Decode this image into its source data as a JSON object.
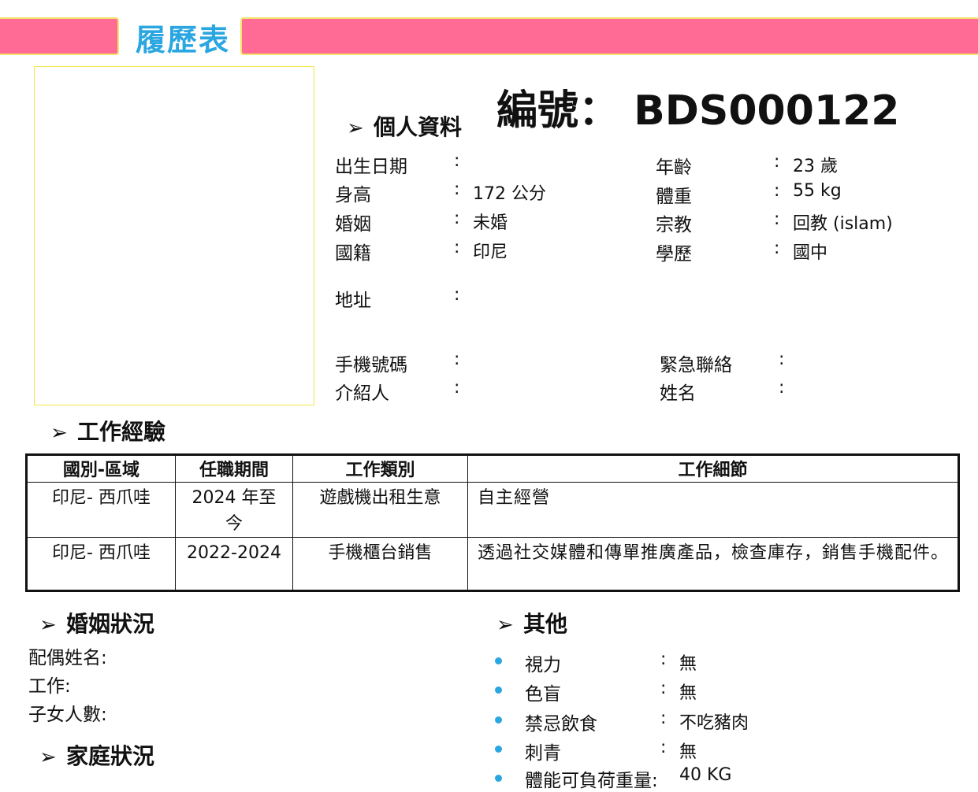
{
  "header": {
    "title": "履歷表",
    "band_color": "#ff6b95",
    "title_color": "#2aa6e0"
  },
  "id_code": "編號： BDS000122",
  "personal": {
    "section_title": "個人資料",
    "left": [
      {
        "label": "出生日期",
        "value": ""
      },
      {
        "label": "身高",
        "value": "172 公分"
      },
      {
        "label": "婚姻",
        "value": "未婚"
      },
      {
        "label": "國籍",
        "value": "印尼"
      }
    ],
    "right": [
      {
        "label": "年齡",
        "value": "23 歲"
      },
      {
        "label": "體重",
        "value": "55 kg"
      },
      {
        "label": "宗教",
        "value": "回教 (islam)"
      },
      {
        "label": "學歷",
        "value": "國中"
      }
    ],
    "address": {
      "label": "地址",
      "value": ""
    },
    "phone": {
      "label": "手機號碼",
      "value": ""
    },
    "referrer": {
      "label": "介紹人",
      "value": ""
    },
    "emergency": {
      "label": "緊急聯絡",
      "value": ""
    },
    "name": {
      "label": "姓名",
      "value": ""
    },
    "colon": ":"
  },
  "work": {
    "section_title": "工作經驗",
    "headers": [
      "國別-區域",
      "任職期間",
      "工作類別",
      "工作細節"
    ],
    "rows": [
      {
        "region": "印尼- 西爪哇",
        "period": "2024 年至今",
        "category": "遊戲機出租生意",
        "detail": "自主經營"
      },
      {
        "region": "印尼- 西爪哇",
        "period": "2022-2024",
        "category": "手機櫃台銷售",
        "detail": "透過社交媒體和傳單推廣產品，檢查庫存，銷售手機配件。"
      }
    ]
  },
  "marriage": {
    "section_title": "婚姻狀況",
    "spouse_label": "配偶姓名:",
    "job_label": "工作:",
    "children_label": "子女人數:"
  },
  "family": {
    "section_title": "家庭狀況"
  },
  "other": {
    "section_title": "其他",
    "items": [
      {
        "label": "視力",
        "value": "無"
      },
      {
        "label": "色盲",
        "value": "無"
      },
      {
        "label": "禁忌飲食",
        "value": "不吃豬肉"
      },
      {
        "label": "刺青",
        "value": "無"
      },
      {
        "label": "體能可負荷重量:",
        "value": "40 KG"
      }
    ],
    "bullet_color": "#2aa6e0"
  },
  "icons": {
    "section_marker": "arrowhead-icon"
  }
}
